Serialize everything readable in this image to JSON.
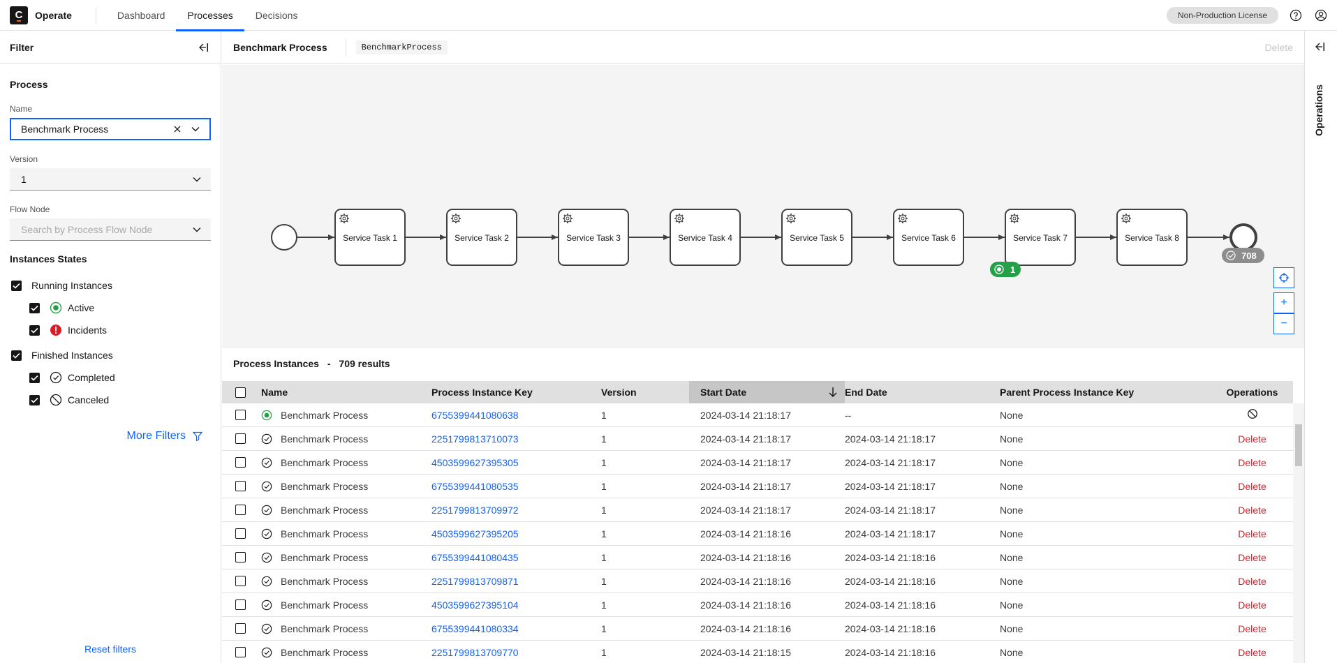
{
  "header": {
    "logo_letter": "C",
    "brand": "Operate",
    "tabs": [
      "Dashboard",
      "Processes",
      "Decisions"
    ],
    "active_tab": "Processes",
    "license": "Non-Production License"
  },
  "filters": {
    "title": "Filter",
    "process_section": "Process",
    "name_label": "Name",
    "name_value": "Benchmark Process",
    "version_label": "Version",
    "version_value": "1",
    "flow_node_label": "Flow Node",
    "flow_node_placeholder": "Search by Process Flow Node",
    "states_title": "Instances States",
    "running": "Running Instances",
    "active": "Active",
    "incidents": "Incidents",
    "finished": "Finished Instances",
    "completed": "Completed",
    "canceled": "Canceled",
    "more_filters": "More Filters",
    "reset": "Reset filters"
  },
  "process": {
    "name": "Benchmark Process",
    "bpmn_id": "BenchmarkProcess",
    "delete_label": "Delete"
  },
  "diagram": {
    "tasks": [
      "Service Task 1",
      "Service Task 2",
      "Service Task 3",
      "Service Task 4",
      "Service Task 5",
      "Service Task 6",
      "Service Task 7",
      "Service Task 8"
    ],
    "active_badge_count": "1",
    "completed_badge_count": "708",
    "zoom_in": "+",
    "zoom_out": "−"
  },
  "instances": {
    "title": "Process Instances",
    "dash": "-",
    "results": "709 results",
    "columns": [
      "Name",
      "Process Instance Key",
      "Version",
      "Start Date",
      "End Date",
      "Parent Process Instance Key",
      "Operations"
    ],
    "rows": [
      {
        "state": "active",
        "name": "Benchmark Process",
        "key": "6755399441080638",
        "version": "1",
        "start": "2024-03-14 21:18:17",
        "end": "--",
        "parent": "None",
        "op": ""
      },
      {
        "state": "completed",
        "name": "Benchmark Process",
        "key": "2251799813710073",
        "version": "1",
        "start": "2024-03-14 21:18:17",
        "end": "2024-03-14 21:18:17",
        "parent": "None",
        "op": "Delete"
      },
      {
        "state": "completed",
        "name": "Benchmark Process",
        "key": "4503599627395305",
        "version": "1",
        "start": "2024-03-14 21:18:17",
        "end": "2024-03-14 21:18:17",
        "parent": "None",
        "op": "Delete"
      },
      {
        "state": "completed",
        "name": "Benchmark Process",
        "key": "6755399441080535",
        "version": "1",
        "start": "2024-03-14 21:18:17",
        "end": "2024-03-14 21:18:17",
        "parent": "None",
        "op": "Delete"
      },
      {
        "state": "completed",
        "name": "Benchmark Process",
        "key": "2251799813709972",
        "version": "1",
        "start": "2024-03-14 21:18:17",
        "end": "2024-03-14 21:18:17",
        "parent": "None",
        "op": "Delete"
      },
      {
        "state": "completed",
        "name": "Benchmark Process",
        "key": "4503599627395205",
        "version": "1",
        "start": "2024-03-14 21:18:16",
        "end": "2024-03-14 21:18:17",
        "parent": "None",
        "op": "Delete"
      },
      {
        "state": "completed",
        "name": "Benchmark Process",
        "key": "6755399441080435",
        "version": "1",
        "start": "2024-03-14 21:18:16",
        "end": "2024-03-14 21:18:16",
        "parent": "None",
        "op": "Delete"
      },
      {
        "state": "completed",
        "name": "Benchmark Process",
        "key": "2251799813709871",
        "version": "1",
        "start": "2024-03-14 21:18:16",
        "end": "2024-03-14 21:18:16",
        "parent": "None",
        "op": "Delete"
      },
      {
        "state": "completed",
        "name": "Benchmark Process",
        "key": "4503599627395104",
        "version": "1",
        "start": "2024-03-14 21:18:16",
        "end": "2024-03-14 21:18:16",
        "parent": "None",
        "op": "Delete"
      },
      {
        "state": "completed",
        "name": "Benchmark Process",
        "key": "6755399441080334",
        "version": "1",
        "start": "2024-03-14 21:18:16",
        "end": "2024-03-14 21:18:16",
        "parent": "None",
        "op": "Delete"
      },
      {
        "state": "completed",
        "name": "Benchmark Process",
        "key": "2251799813709770",
        "version": "1",
        "start": "2024-03-14 21:18:15",
        "end": "2024-03-14 21:18:16",
        "parent": "None",
        "op": "Delete"
      }
    ]
  },
  "operations_panel": {
    "label": "Operations"
  },
  "colors": {
    "accent": "#0f62fe",
    "active": "#24a148",
    "incident": "#da1e28",
    "delete": "#da1e28"
  }
}
